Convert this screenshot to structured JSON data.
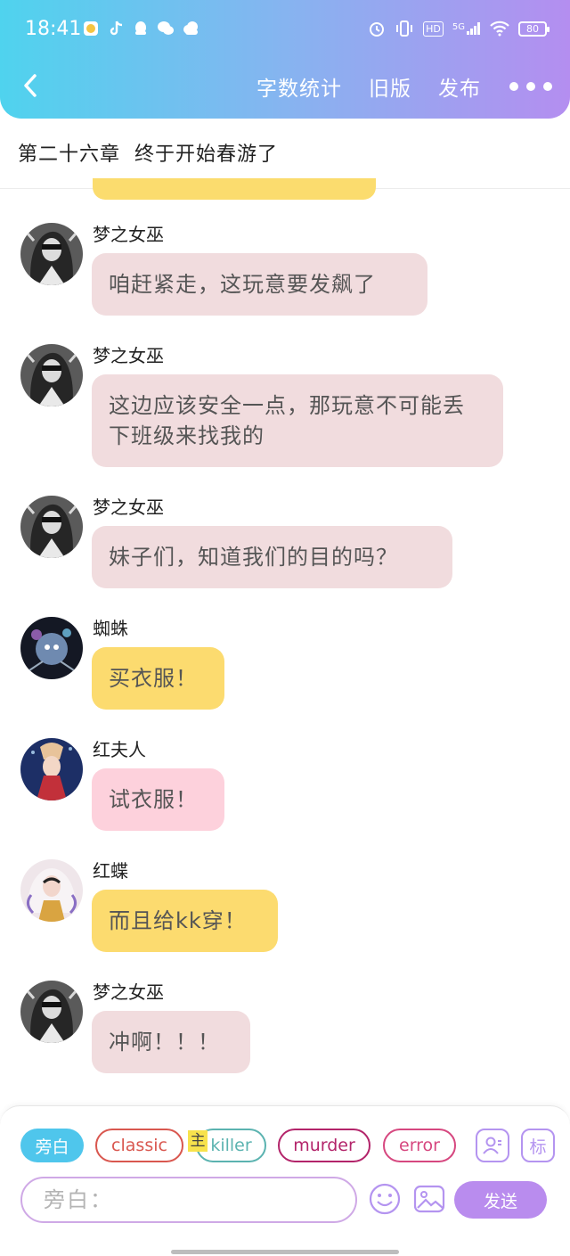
{
  "status_bar": {
    "time": "18:41",
    "network_label": "5G",
    "hd_label": "HD",
    "battery": "80"
  },
  "header": {
    "nav": [
      "字数统计",
      "旧版",
      "发布"
    ],
    "colors": {
      "gradient_start": "#4fd3ee",
      "gradient_end": "#b48ef0"
    }
  },
  "chapter_title": "第二十六章  终于开始春游了",
  "messages": [
    {
      "name": "梦之女巫",
      "text": "咱赶紧走，这玩意要发飙了"
    },
    {
      "name": "梦之女巫",
      "text": "这边应该安全一点，那玩意不可能丢下班级来找我的"
    },
    {
      "name": "梦之女巫",
      "text": "妹子们，知道我们的目的吗？"
    },
    {
      "name": "蜘蛛",
      "text": "买衣服！"
    },
    {
      "name": "红夫人",
      "text": "试衣服！"
    },
    {
      "name": "红蝶",
      "text": "而且给kk穿！"
    },
    {
      "name": "梦之女巫",
      "text": "冲啊！！！"
    }
  ],
  "role_chips": [
    {
      "label": "旁白",
      "color": "#4fc6ec"
    },
    {
      "label": "classic",
      "color": "#d9574f"
    },
    {
      "label": "killer",
      "color": "#5bb3b0"
    },
    {
      "label": "murder",
      "color": "#b3246a"
    },
    {
      "label": "error",
      "color": "#d6477f"
    }
  ],
  "main_tag": "主",
  "mark_button": "标",
  "input": {
    "placeholder": "旁白："
  },
  "send_label": "发送",
  "icons": [
    "back-icon",
    "more-icon",
    "role-manage-icon",
    "emoji-icon",
    "image-icon"
  ]
}
